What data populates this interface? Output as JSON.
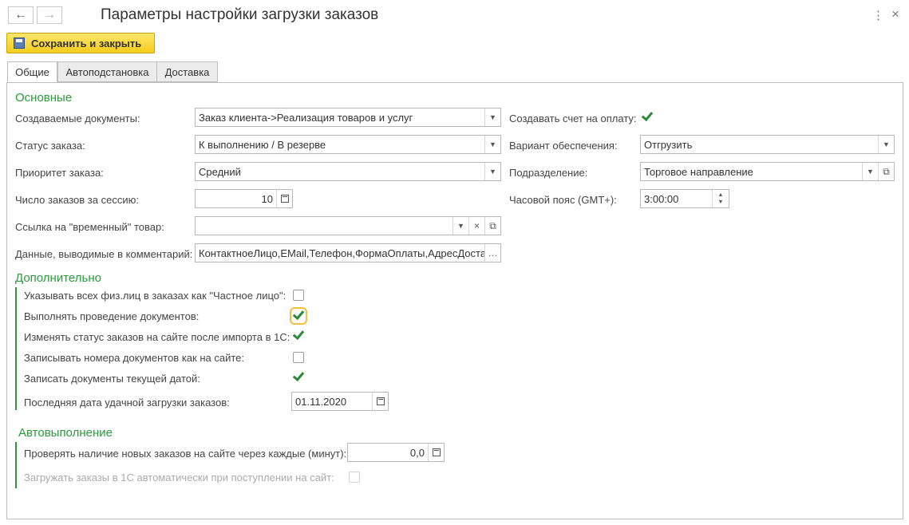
{
  "window": {
    "title": "Параметры настройки загрузки заказов"
  },
  "nav": {
    "back_icon": "←",
    "forward_icon": "→"
  },
  "window_controls": {
    "more_icon": "⋮",
    "close_icon": "×"
  },
  "toolbar": {
    "save_label": "Сохранить и закрыть"
  },
  "tabs": [
    {
      "label": "Общие",
      "active": true
    },
    {
      "label": "Автоподстановка",
      "active": false
    },
    {
      "label": "Доставка",
      "active": false
    }
  ],
  "main": {
    "title": "Основные",
    "docs": {
      "label": "Создаваемые документы:",
      "value": "Заказ клиента->Реализация товаров и услуг"
    },
    "status": {
      "label": "Статус заказа:",
      "value": "К выполнению / В резерве"
    },
    "priority": {
      "label": "Приоритет заказа:",
      "value": "Средний"
    },
    "count": {
      "label": "Число заказов за сессию:",
      "value": "10"
    },
    "temp_link": {
      "label": "Ссылка на \"временный\" товар:",
      "value": ""
    },
    "comment": {
      "label": "Данные, выводимые в комментарий:",
      "value": "КонтактноеЛицо,EMail,Телефон,ФормаОплаты,АдресДоста"
    },
    "invoice": {
      "label": "Создавать счет на оплату:",
      "checked": true
    },
    "supply": {
      "label": "Вариант обеспечения:",
      "value": "Отгрузить"
    },
    "division": {
      "label": "Подразделение:",
      "value": "Торговое направление"
    },
    "timezone": {
      "label": "Часовой пояс (GMT+):",
      "value": "3:00:00"
    }
  },
  "extra": {
    "title": "Дополнительно",
    "private_person": {
      "label": "Указывать всех физ.лиц в заказах как \"Частное лицо\":",
      "checked": false
    },
    "post_docs": {
      "label": "Выполнять проведение документов:",
      "checked": true
    },
    "change_status": {
      "label": "Изменять статус заказов на сайте после импорта в 1С:",
      "checked": true
    },
    "doc_numbers": {
      "label": "Записывать номера документов как на сайте:",
      "checked": false
    },
    "current_date": {
      "label": "Записать документы текущей датой:",
      "checked": true
    },
    "last_date": {
      "label": "Последняя дата удачной загрузки заказов:",
      "value": "01.11.2020"
    }
  },
  "auto": {
    "title": "Автовыполнение",
    "interval": {
      "label": "Проверять наличие новых заказов на сайте через каждые (минут):",
      "value": "0,0"
    },
    "auto_load": {
      "label": "Загружать заказы в 1С автоматически при поступлении на сайт:",
      "checked": false
    }
  },
  "colors": {
    "accent": "#2a9a3a",
    "save_button": "#f5cc1c"
  }
}
